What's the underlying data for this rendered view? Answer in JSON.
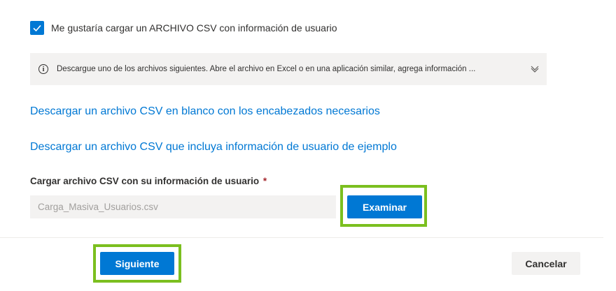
{
  "csv_option": {
    "checked": true,
    "label": "Me gustaría cargar un ARCHIVO CSV con información de usuario"
  },
  "info": {
    "icon": "info-icon",
    "text": "Descargue uno de los archivos siguientes. Abre el archivo en Excel o en una aplicación similar, agrega información ...",
    "expand_icon": "chevron-down-icon"
  },
  "links": {
    "blank_csv": "Descargar un archivo CSV en blanco con los encabezados necesarios",
    "sample_csv": "Descargar un archivo CSV que incluya información de usuario de ejemplo"
  },
  "upload": {
    "label": "Cargar archivo CSV con su información de usuario",
    "required_mark": "*",
    "file_value": "Carga_Masiva_Usuarios.csv",
    "browse_label": "Examinar"
  },
  "footer": {
    "next_label": "Siguiente",
    "cancel_label": "Cancelar"
  },
  "colors": {
    "accent": "#0078d4",
    "highlight": "#7bbf1f",
    "required": "#a4262c"
  }
}
